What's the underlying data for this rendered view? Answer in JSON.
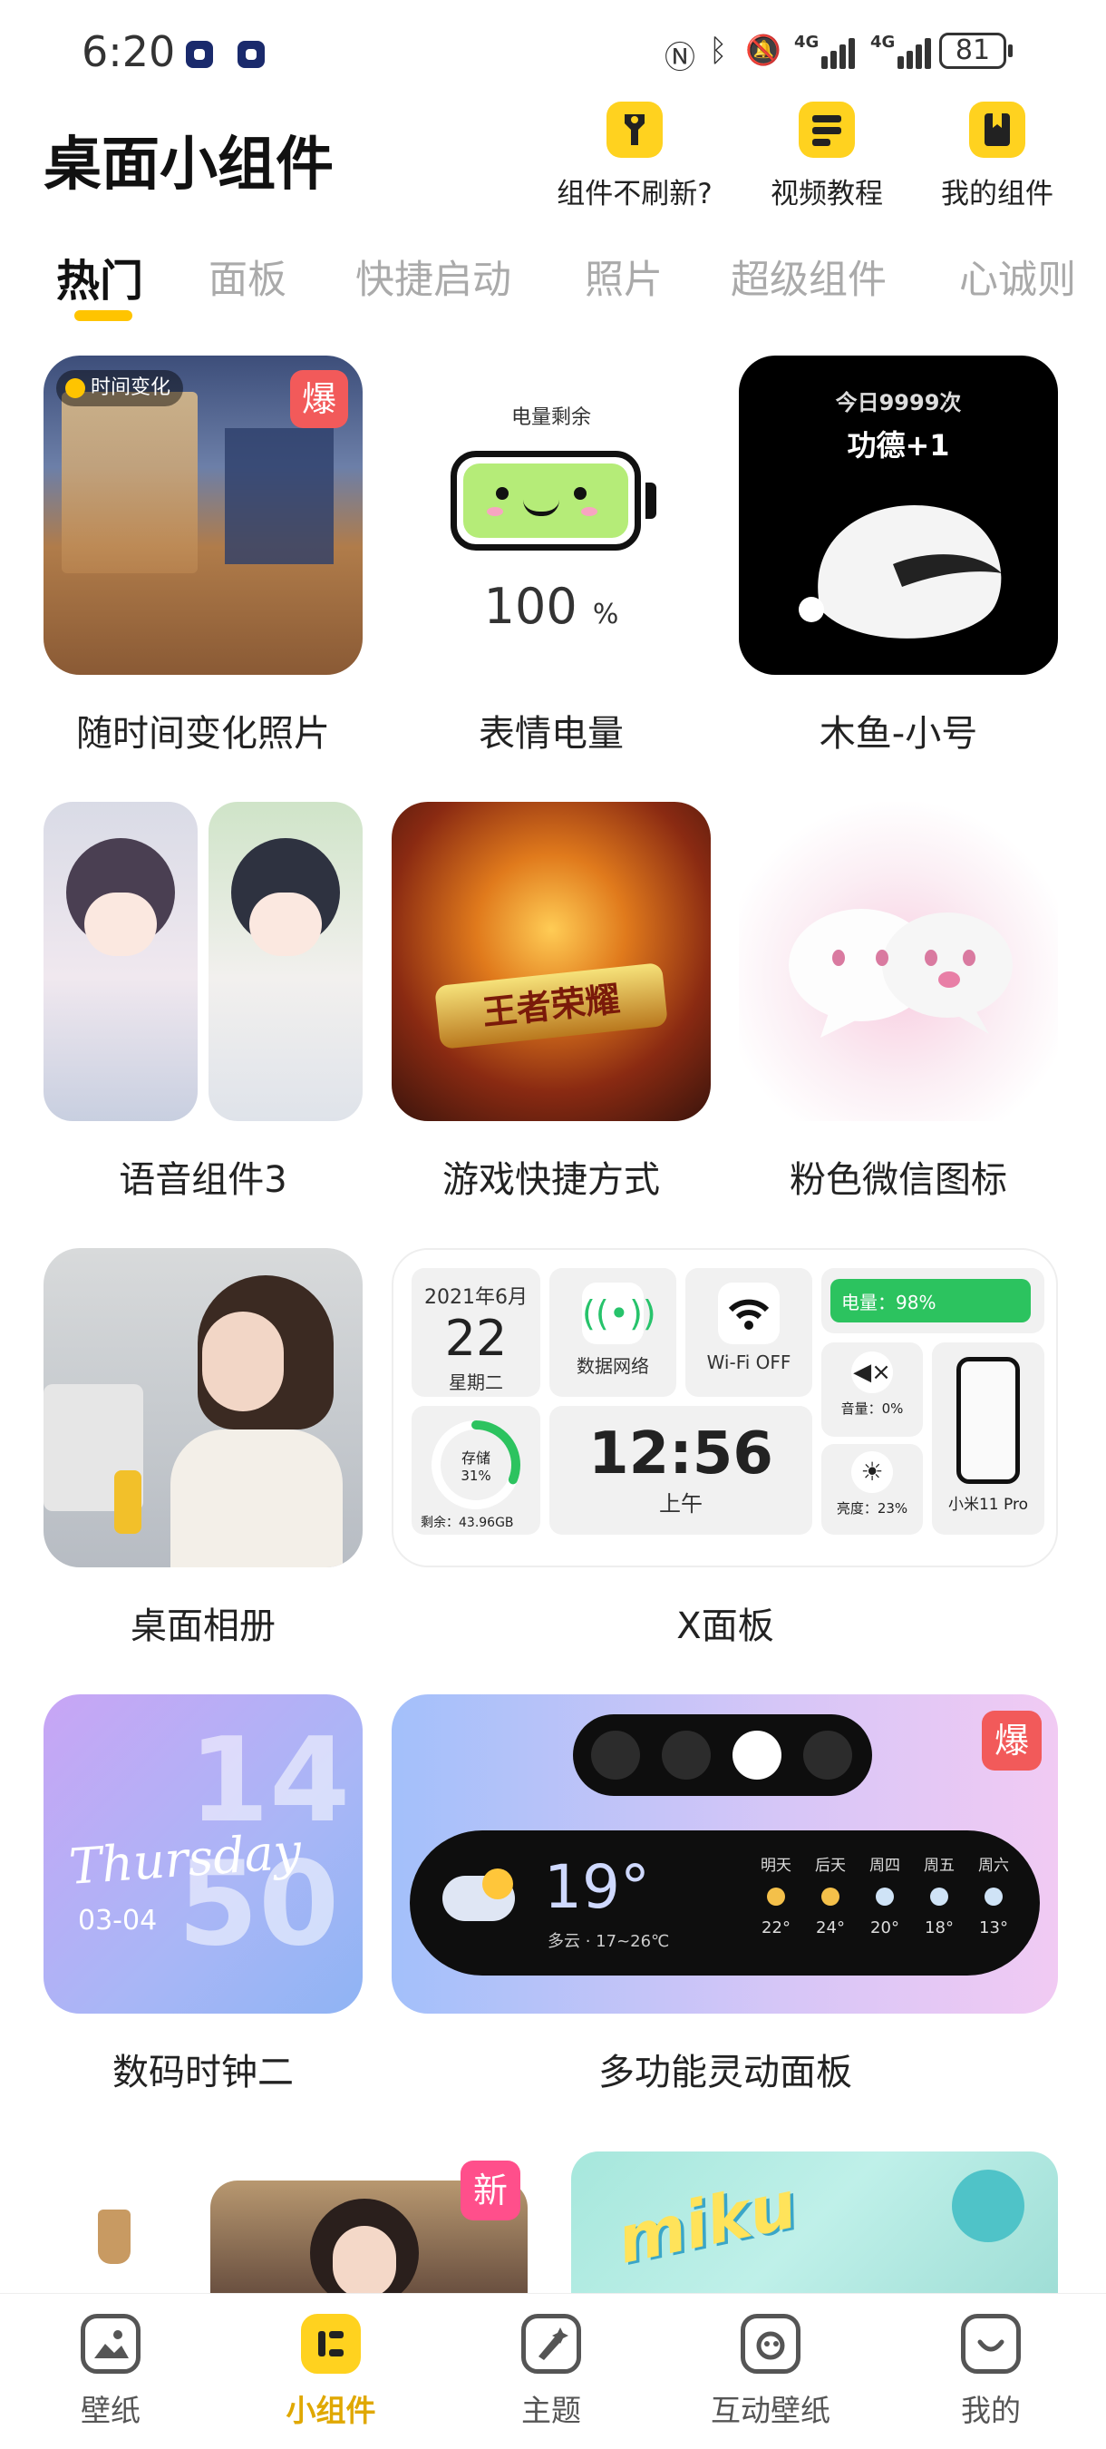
{
  "status_bar": {
    "time": "6:20",
    "battery": "81",
    "network_label_1": "4G",
    "network_label_2": "4G"
  },
  "header": {
    "title": "桌面小组件",
    "actions": [
      {
        "label": "组件不刷新?",
        "icon": "wrench-icon"
      },
      {
        "label": "视频教程",
        "icon": "video-guide-icon"
      },
      {
        "label": "我的组件",
        "icon": "bookmark-icon"
      }
    ]
  },
  "tabs": [
    "热门",
    "面板",
    "快捷启动",
    "照片",
    "超级组件",
    "心诚则"
  ],
  "colors": {
    "accent": "#ffc400",
    "accent_text": "#e0a800",
    "hot_badge": "#f25a5a",
    "new_badge": "#ff4f8b"
  },
  "widgets": {
    "w1": {
      "caption": "随时间变化照片",
      "tag": "时间变化",
      "badge": "爆"
    },
    "w2": {
      "caption": "表情电量",
      "heading": "电量剩余",
      "value": "100",
      "unit": "%"
    },
    "w3": {
      "caption": "木鱼-小号",
      "count": "今日9999次",
      "merit": "功德+1"
    },
    "w4": {
      "caption": "语音组件3"
    },
    "w5": {
      "caption": "游戏快捷方式",
      "game_logo": "王者荣耀"
    },
    "w6": {
      "caption": "粉色微信图标"
    },
    "w7": {
      "caption": "桌面相册"
    },
    "w8": {
      "caption": "X面板",
      "date_line": "2021年6月",
      "day": "22",
      "weekday": "星期二",
      "data_label": "数据网络",
      "wifi_label": "Wi-Fi OFF",
      "power": "电量：98%",
      "power_fraction": 0.98,
      "storage_label": "存储",
      "storage_pct": "31%",
      "storage_fraction": 0.31,
      "storage_left": "剩余：43.96GB",
      "clock": "12:56",
      "ampm": "上午",
      "volume": "音量：0%",
      "brightness": "亮度：23%",
      "device": "小米11 Pro"
    },
    "w9": {
      "caption": "数码时钟二",
      "hour": "14",
      "minute": "50",
      "weekday": "Thursday",
      "date": "03-04"
    },
    "w10": {
      "caption": "多功能灵动面板",
      "badge": "爆",
      "temp": "19°",
      "desc": "多云 · 17~26℃",
      "forecast": [
        {
          "day": "明天",
          "temp": "22°"
        },
        {
          "day": "后天",
          "temp": "24°"
        },
        {
          "day": "周四",
          "temp": "20°"
        },
        {
          "day": "周五",
          "temp": "18°"
        },
        {
          "day": "周六",
          "temp": "13°"
        }
      ]
    },
    "w11": {
      "badge": "新"
    },
    "w12": {
      "title": "miku"
    }
  },
  "bottom_nav": [
    {
      "label": "壁纸",
      "icon": "wallpaper-icon"
    },
    {
      "label": "小组件",
      "icon": "widget-icon",
      "active": true
    },
    {
      "label": "主题",
      "icon": "theme-icon"
    },
    {
      "label": "互动壁纸",
      "icon": "interactive-wallpaper-icon"
    },
    {
      "label": "我的",
      "icon": "profile-icon"
    }
  ]
}
